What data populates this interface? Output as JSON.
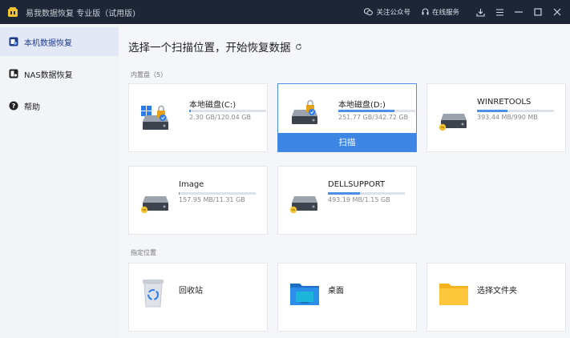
{
  "app": {
    "title": "易我数据恢复 专业版（试用版)"
  },
  "titlebar": {
    "follow_label": "关注公众号",
    "service_label": "在线服务"
  },
  "sidebar": {
    "items": [
      {
        "label": "本机数据恢复",
        "active": true,
        "icon": "local-recovery-icon"
      },
      {
        "label": "NAS数据恢复",
        "active": false,
        "icon": "nas-recovery-icon"
      },
      {
        "label": "帮助",
        "active": false,
        "icon": "help-icon"
      }
    ]
  },
  "main": {
    "title": "选择一个扫描位置，开始恢复数据",
    "drives_section": "内置盘（5）",
    "drives": [
      {
        "name": "本地磁盘(C:)",
        "size": "2.30 GB/120.04 GB",
        "usage": 0.02,
        "icon": "windows-drive-icon"
      },
      {
        "name": "本地磁盘(D:)",
        "size": "251.77 GB/342.72 GB",
        "usage": 0.73,
        "icon": "locked-drive-icon"
      },
      {
        "name": "WINRETOOLS",
        "size": "393.44 MB/990 MB",
        "usage": 0.4,
        "icon": "drive-icon"
      },
      {
        "name": "Image",
        "size": "157.95 MB/11.31 GB",
        "usage": 0.014,
        "icon": "drive-icon"
      },
      {
        "name": "DELLSUPPORT",
        "size": "493.19 MB/1.15 GB",
        "usage": 0.42,
        "icon": "drive-icon"
      }
    ],
    "scan_label": "扫描",
    "locations_section": "指定位置",
    "locations": [
      {
        "name": "回收站",
        "icon": "recycle-bin-icon"
      },
      {
        "name": "桌面",
        "icon": "desktop-folder-icon"
      },
      {
        "name": "选择文件夹",
        "icon": "folder-icon"
      }
    ]
  },
  "colors": {
    "accent": "#3e86e4",
    "titlebar": "#1d2636",
    "sidebar_active": "#e2e8f5"
  }
}
